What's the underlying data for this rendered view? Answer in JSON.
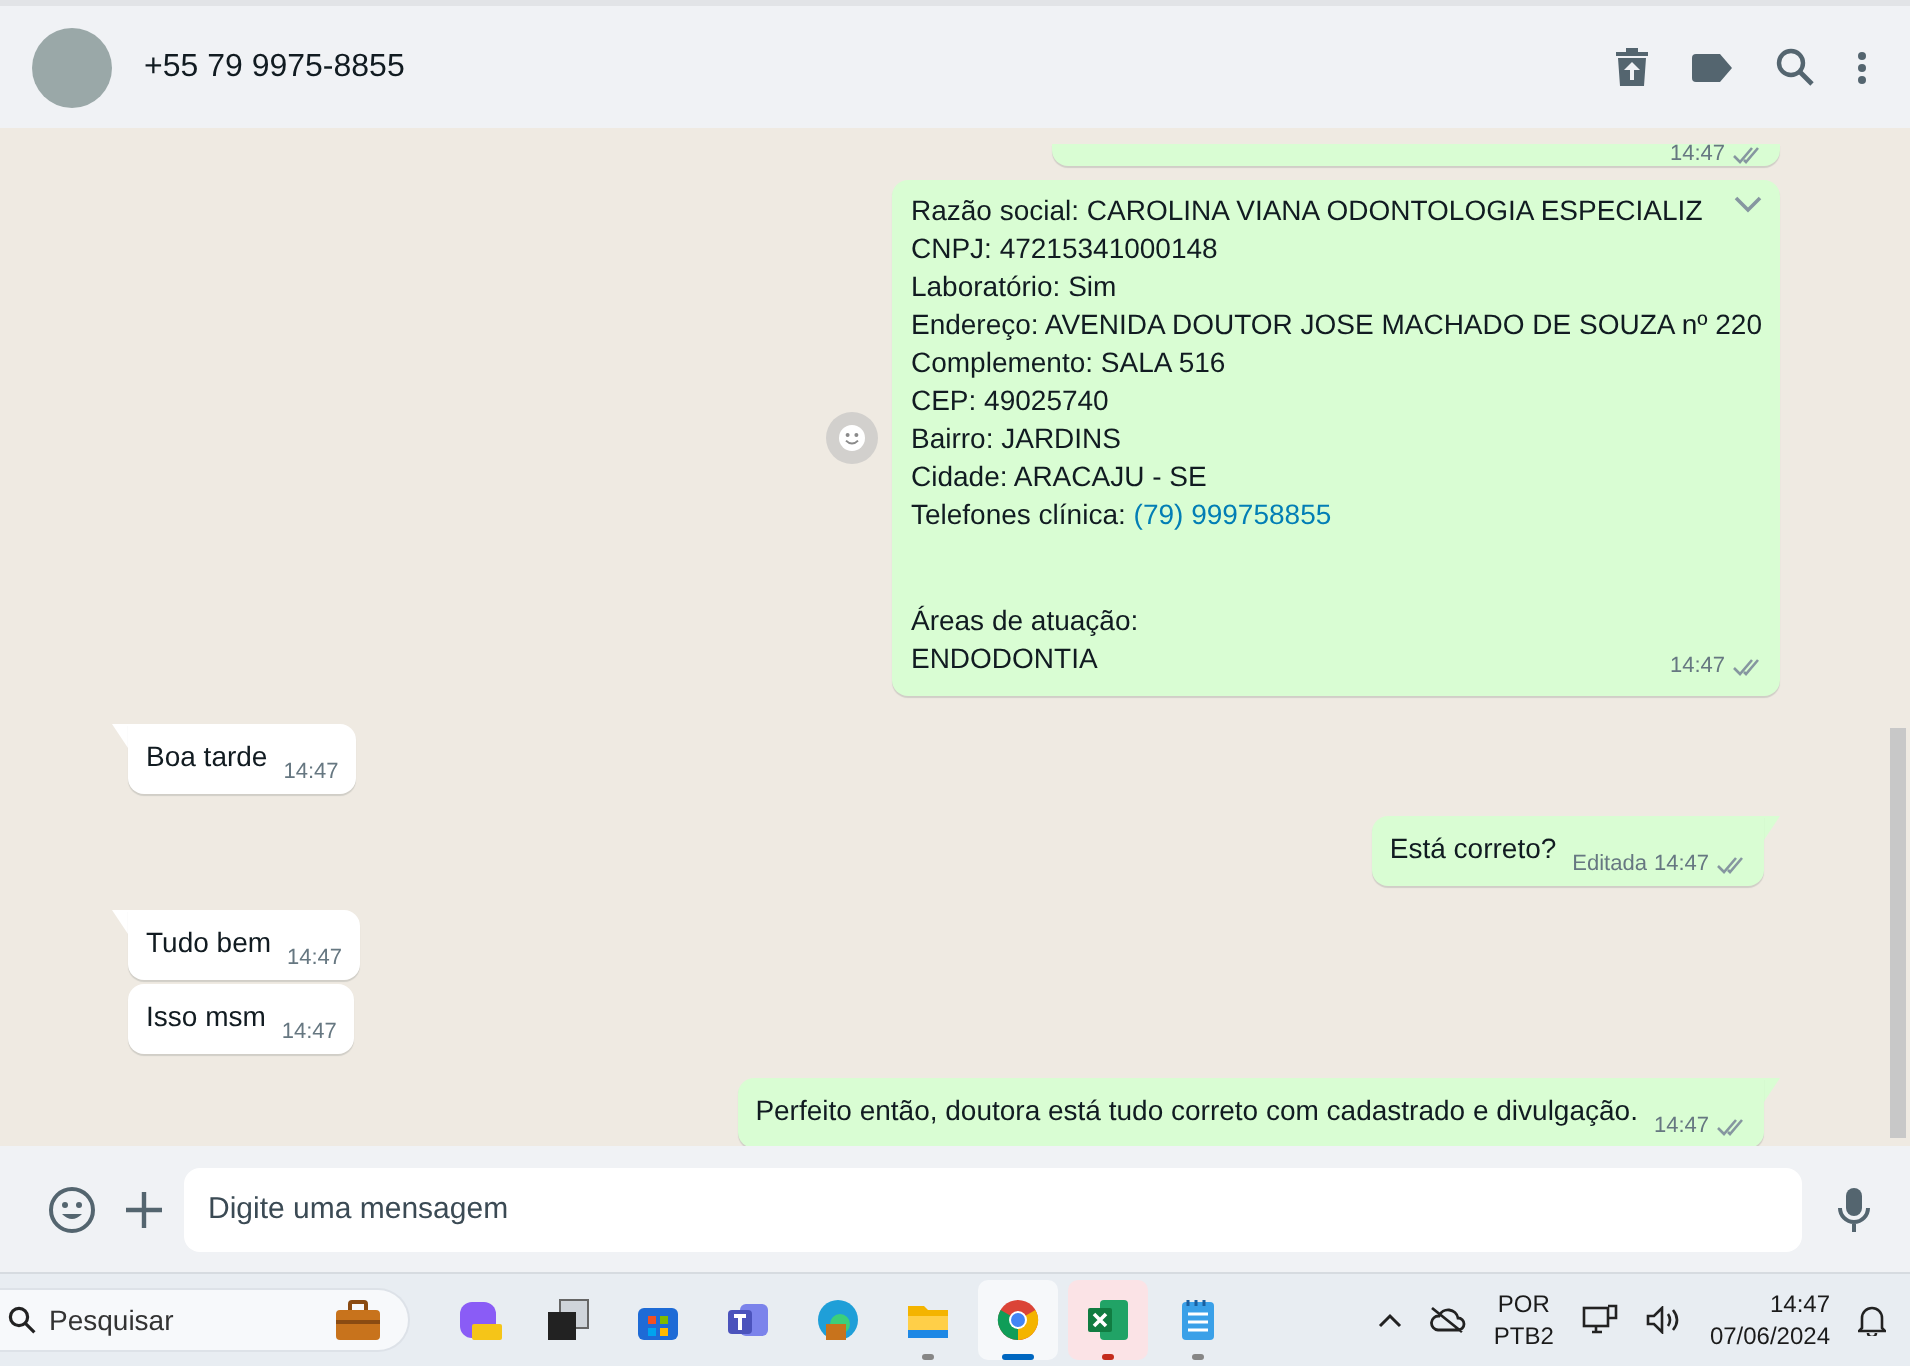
{
  "header": {
    "contact": "+55 79 9975-8855"
  },
  "messages": [
    {
      "outgoing": true,
      "cut_top": true,
      "time": "14:47",
      "read": false
    },
    {
      "outgoing": true,
      "paragraphs": [
        [
          {
            "text": "Razão social: CAROLINA VIANA ODONTOLOGIA ESPECIALIZ"
          },
          {
            "text": "CNPJ: 47215341000148"
          },
          {
            "text": "Laboratório: Sim"
          },
          {
            "text": "Endereço: AVENIDA DOUTOR JOSE MACHADO DE SOUZA nº 220"
          },
          {
            "text": "Complemento: SALA 516"
          },
          {
            "text": "CEP: 49025740"
          },
          {
            "text": "Bairro: JARDINS"
          },
          {
            "text": "Cidade: ARACAJU - SE"
          },
          {
            "text": "Telefones clínica: ",
            "link": "(79) 999758855"
          }
        ],
        [
          {
            "text": "Áreas de atuação:"
          },
          {
            "text": "ENDODONTIA"
          }
        ]
      ],
      "time": "14:47",
      "read": false,
      "menu": true,
      "react": true
    },
    {
      "outgoing": false,
      "text": "Boa tarde",
      "time": "14:47",
      "tail": true
    },
    {
      "outgoing": true,
      "text": "Está correto?",
      "edited": "Editada",
      "time": "14:47",
      "read": false,
      "tail": true
    },
    {
      "outgoing": false,
      "text": "Tudo bem",
      "time": "14:47",
      "tail": true
    },
    {
      "outgoing": false,
      "text": "Isso msm",
      "time": "14:47",
      "tail": false
    },
    {
      "outgoing": true,
      "text": "Perfeito então, doutora está tudo correto com cadastrado e divulgação.",
      "time": "14:47",
      "read": false,
      "tail": true
    }
  ],
  "composer": {
    "placeholder": "Digite uma mensagem"
  },
  "taskbar": {
    "search_placeholder": "Pesquisar",
    "apps": [
      {
        "kind": "copilot",
        "running": false,
        "active": false,
        "attention": false
      },
      {
        "kind": "taskview",
        "running": false,
        "active": false,
        "attention": false
      },
      {
        "kind": "store",
        "running": false,
        "active": false,
        "attention": false
      },
      {
        "kind": "teams",
        "running": false,
        "active": false,
        "attention": false
      },
      {
        "kind": "edge",
        "running": false,
        "active": false,
        "attention": false
      },
      {
        "kind": "folder",
        "running": true,
        "active": false,
        "attention": false
      },
      {
        "kind": "chrome",
        "running": true,
        "active": true,
        "attention": false
      },
      {
        "kind": "excel",
        "running": true,
        "active": false,
        "attention": true
      },
      {
        "kind": "notepad",
        "running": true,
        "active": false,
        "attention": false
      }
    ],
    "language": [
      "POR",
      "PTB2"
    ],
    "time": "14:47",
    "date": "07/06/2024"
  }
}
